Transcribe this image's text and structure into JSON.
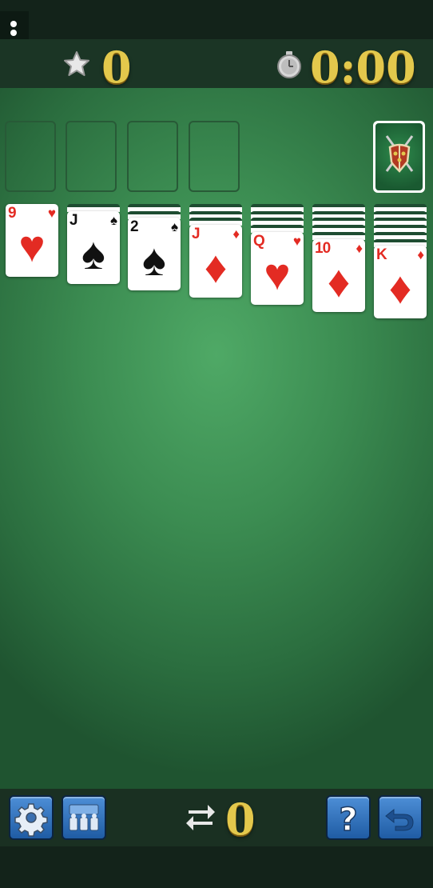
{
  "header": {
    "score": "0",
    "timer": "0:00",
    "icons": {
      "menu": "vertical-dots-icon",
      "score": "star-icon",
      "timer": "stopwatch-icon"
    }
  },
  "board": {
    "foundations": 4,
    "stock_icon": "shield-crossed-swords-icon",
    "tableau": [
      {
        "face_down": 0,
        "top_card": {
          "rank": "9",
          "suit": "♥",
          "color": "red"
        }
      },
      {
        "face_down": 1,
        "top_card": {
          "rank": "J",
          "suit": "♠",
          "color": "black"
        }
      },
      {
        "face_down": 2,
        "top_card": {
          "rank": "2",
          "suit": "♠",
          "color": "black"
        }
      },
      {
        "face_down": 3,
        "top_card": {
          "rank": "J",
          "suit": "♦",
          "color": "red"
        }
      },
      {
        "face_down": 4,
        "top_card": {
          "rank": "Q",
          "suit": "♥",
          "color": "red"
        }
      },
      {
        "face_down": 5,
        "top_card": {
          "rank": "10",
          "suit": "♦",
          "color": "red"
        }
      },
      {
        "face_down": 6,
        "top_card": {
          "rank": "K",
          "suit": "♦",
          "color": "red"
        }
      }
    ]
  },
  "toolbar": {
    "moves": "0",
    "icons": {
      "settings": "gear-icon",
      "deal": "cards-icon",
      "moves": "swap-arrows-icon",
      "help": "question-icon",
      "undo": "undo-icon"
    }
  },
  "colors": {
    "felt_center": "#4fa966",
    "felt_edge": "#1f5430",
    "gold": "#e3c84c",
    "button_blue": "#2f6fb8",
    "red_suit": "#e32b23"
  }
}
